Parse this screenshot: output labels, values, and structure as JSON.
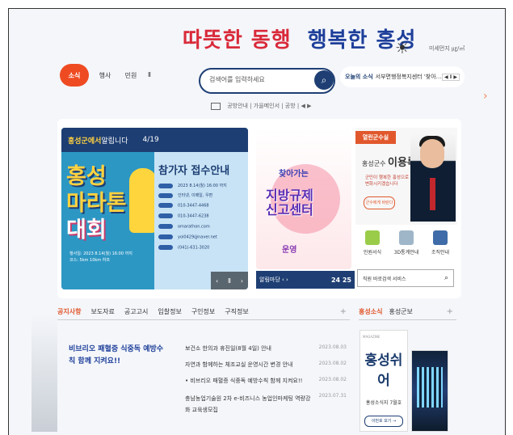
{
  "header": {
    "logo_part1": "따뜻한 동행",
    "logo_part2": "행복한 홍성",
    "weather_label": "미세먼지 ㎍/㎥"
  },
  "nav_tabs": [
    {
      "label": "소식",
      "active": true
    },
    {
      "label": "행사",
      "active": false
    },
    {
      "label": "민원",
      "active": false
    }
  ],
  "pause_icon": "Ⅱ",
  "search": {
    "placeholder": "검색어를 입력하세요"
  },
  "ticker": {
    "label": "오늘의 소식",
    "text": "서부면행정복지센터 '찾아...",
    "controls": "◀ Ⅱ ▶"
  },
  "quick_links": {
    "text": "공방안내 | 가을메인서 | 공방 | ◀ ▶"
  },
  "banner1": {
    "header_strong": "홍성군에서",
    "header_rest": " 알립니다",
    "counter": "4/19",
    "title_line1": "홍성",
    "title_line2": "마라톤",
    "title_line3": "대회",
    "info": "행사일: 2023 8.14(월) 16:00 까지",
    "info2": "코스: 5km 10km 하프",
    "right_title": "참가자 접수안내",
    "rows": [
      "2023 8.14(월) 16:00 까지",
      "인터넷, 이메일, 우편",
      "010-3447-4468",
      "010-3447-6238",
      "omarathon.com",
      "yoi0429@naver.net",
      "(041)-631-3020"
    ],
    "nav": [
      "‹",
      "Ⅱ",
      "›"
    ]
  },
  "banner2": {
    "sub": "찾아가는",
    "title_line1": "지방규제",
    "title_line2": "신고센터",
    "bottom": "운영"
  },
  "banner2_nav": {
    "label": "알림마당 ‹ ›",
    "count": "24 25"
  },
  "profile": {
    "badge": "열린군수실",
    "name_prefix": "홍성군수 ",
    "name": "이용록",
    "text1": "군민이 행복한 홍성으로",
    "text2": "변화시키겠습니다",
    "button": "군수에게 바란다"
  },
  "quick_icons": [
    {
      "label": "민원서식",
      "color": "#9acc4a"
    },
    {
      "label": "3D통계안내",
      "color": "#9fb6c9"
    },
    {
      "label": "조직안내",
      "color": "#3f6ca8"
    }
  ],
  "site_search": {
    "placeholder": "직원 바로검색 서비스"
  },
  "notice_tabs": [
    "공지사항",
    "보도자료",
    "공고고시",
    "입찰정보",
    "구인정보",
    "구직정보"
  ],
  "notice_plus": "+",
  "hongseong_tabs": [
    "홍성소식",
    "홍성군보"
  ],
  "feature": {
    "title": "비브리오 패혈증 식중독 예방수칙 함께 지켜요!!"
  },
  "news": [
    {
      "title": "보건소 한의과 휴진일(8월 4일) 안내",
      "date": "2023.08.03"
    },
    {
      "title": "자연과 함께하는 체조교실 운영시간 변경 안내",
      "date": "2023.08.02"
    },
    {
      "title": "• 비브리오 패혈증 식중독 예방수칙 함께 지켜요!!",
      "date": "2023.08.02"
    },
    {
      "title": "충남농업기술원 2차 e-비즈니스 농업인마케팅 역량강화 교육생모집",
      "date": "2023.07.31"
    }
  ],
  "magazine": {
    "top": "MAGAZINE",
    "title": "홍성쉬어",
    "label": "홍성소식지 7월호",
    "button": "이번호 보기 →"
  },
  "colors": {
    "accent": "#ef4b23",
    "navy": "#1f3f74",
    "brand_red": "#d92a3a",
    "brand_blue": "#1e3f9a"
  }
}
